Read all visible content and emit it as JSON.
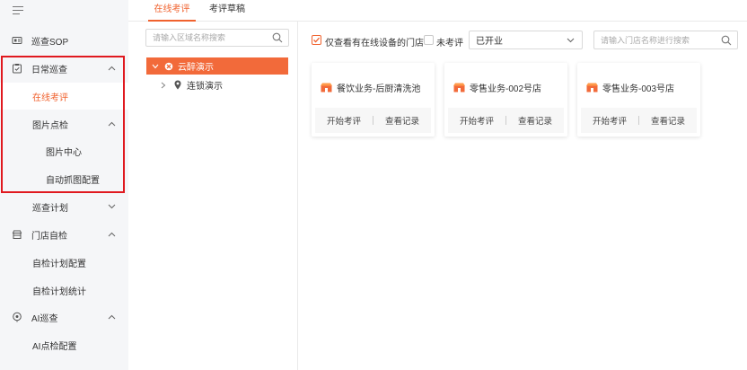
{
  "sidebar": {
    "items": [
      {
        "label": "巡查SOP"
      },
      {
        "label": "日常巡查"
      },
      {
        "label": "在线考评"
      },
      {
        "label": "图片点检"
      },
      {
        "label": "图片中心"
      },
      {
        "label": "自动抓图配置"
      },
      {
        "label": "巡查计划"
      },
      {
        "label": "门店自检"
      },
      {
        "label": "自检计划配置"
      },
      {
        "label": "自检计划统计"
      },
      {
        "label": "AI巡查"
      },
      {
        "label": "AI点检配置"
      }
    ]
  },
  "tabs": [
    {
      "label": "在线考评"
    },
    {
      "label": "考评草稿"
    }
  ],
  "tree": {
    "search_placeholder": "请输入区域名称搜索",
    "nodes": [
      {
        "label": "云醉演示"
      },
      {
        "label": "连锁演示"
      }
    ]
  },
  "filters": {
    "only_online_label": "仅查看有在线设备的门店",
    "not_evaluated_label": "未考评",
    "status_value": "已开业",
    "store_search_placeholder": "请输入门店名称进行搜索"
  },
  "cards": [
    {
      "name": "餐饮业务-后厨清洗池",
      "start_label": "开始考评",
      "record_label": "查看记录"
    },
    {
      "name": "零售业务-002号店",
      "start_label": "开始考评",
      "record_label": "查看记录"
    },
    {
      "name": "零售业务-003号店",
      "start_label": "开始考评",
      "record_label": "查看记录"
    }
  ],
  "colors": {
    "accent": "#f0622e",
    "highlight": "#e0191f",
    "sidebar_bg": "#f5f6f8"
  }
}
